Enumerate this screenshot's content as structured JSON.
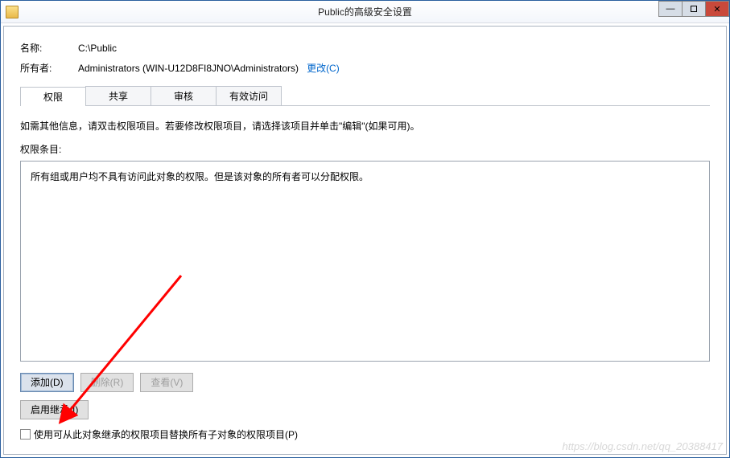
{
  "titlebar": {
    "title": "Public的高级安全设置"
  },
  "info": {
    "name_label": "名称:",
    "name_value": "C:\\Public",
    "owner_label": "所有者:",
    "owner_value": "Administrators (WIN-U12D8FI8JNO\\Administrators)",
    "change_link": "更改(C)"
  },
  "tabs": {
    "items": [
      {
        "label": "权限"
      },
      {
        "label": "共享"
      },
      {
        "label": "审核"
      },
      {
        "label": "有效访问"
      }
    ]
  },
  "instruction": "如需其他信息，请双击权限项目。若要修改权限项目，请选择该项目并单击\"编辑\"(如果可用)。",
  "entries_label": "权限条目:",
  "entries_text": "所有组或用户均不具有访问此对象的权限。但是该对象的所有者可以分配权限。",
  "buttons": {
    "add": "添加(D)",
    "remove": "删除(R)",
    "view": "查看(V)",
    "enable_inherit": "启用继承(I)"
  },
  "checkbox": {
    "label": "使用可从此对象继承的权限项目替换所有子对象的权限项目(P)"
  },
  "watermark": "https://blog.csdn.net/qq_20388417"
}
